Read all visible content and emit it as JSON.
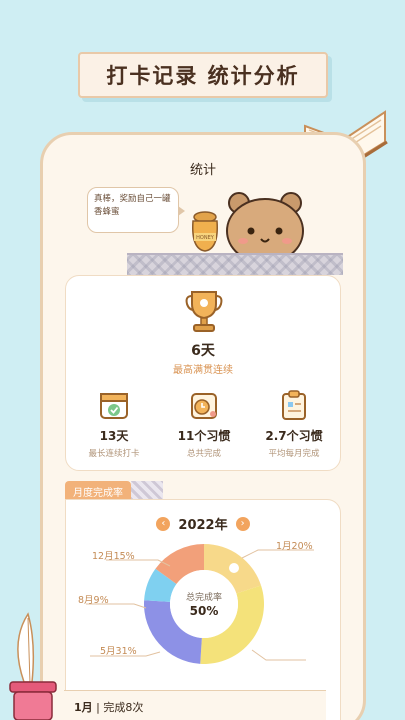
{
  "headline": "打卡记录  统计分析",
  "screen": {
    "title": "统计",
    "bubble": "真棒，奖励自己一罐香蜂蜜",
    "honey_label": "HONEY"
  },
  "best": {
    "value": "6天",
    "label": "最高满贯连续"
  },
  "stats": [
    {
      "value": "13天",
      "label": "最长连续打卡",
      "icon": "calendar-check-icon"
    },
    {
      "value": "11个习惯",
      "label": "总共完成",
      "icon": "clock-card-icon"
    },
    {
      "value": "2.7个习惯",
      "label": "平均每月完成",
      "icon": "clipboard-icon"
    }
  ],
  "monthly": {
    "tab_label": "月度完成率",
    "year": "2022年",
    "prev": "‹",
    "next": "›",
    "center_title": "总完成率",
    "center_value": "50%",
    "slice_labels": {
      "jan": "1月20%",
      "dec": "12月15%",
      "aug": "8月9%",
      "may": "5月31%"
    }
  },
  "chart_data": {
    "type": "pie",
    "categories": [
      "1月",
      "5月",
      "8月",
      "12月"
    ],
    "values": [
      20,
      31,
      9,
      15
    ],
    "colors": [
      "#f7d98a",
      "#f4e27a",
      "#7fd0f0",
      "#f2a07a"
    ],
    "extra_unlabeled_slice_color": "#8d91e6"
  },
  "bottom": {
    "month": "1月",
    "sep": " | ",
    "text": "完成8次"
  }
}
